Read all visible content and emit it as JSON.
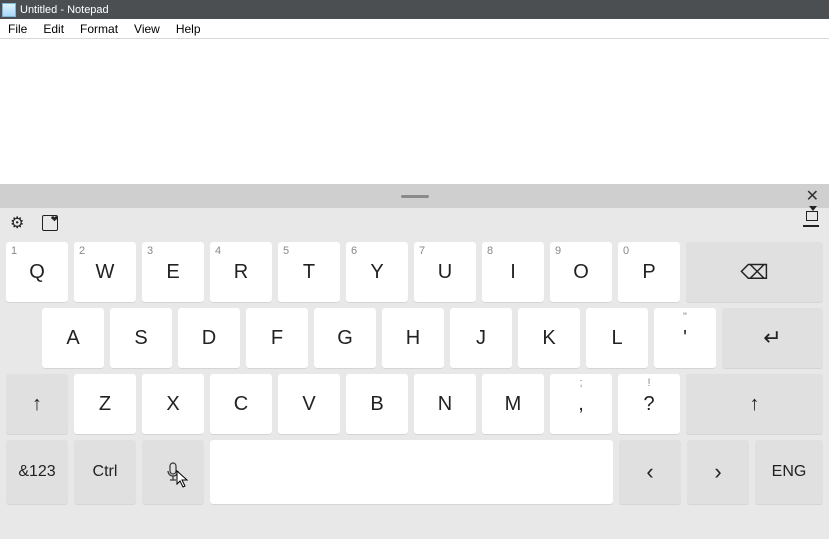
{
  "title": "Untitled - Notepad",
  "menu": {
    "file": "File",
    "edit": "Edit",
    "format": "Format",
    "view": "View",
    "help": "Help"
  },
  "osk": {
    "row1": [
      {
        "num": "1",
        "ch": "Q"
      },
      {
        "num": "2",
        "ch": "W"
      },
      {
        "num": "3",
        "ch": "E"
      },
      {
        "num": "4",
        "ch": "R"
      },
      {
        "num": "5",
        "ch": "T"
      },
      {
        "num": "6",
        "ch": "Y"
      },
      {
        "num": "7",
        "ch": "U"
      },
      {
        "num": "8",
        "ch": "I"
      },
      {
        "num": "9",
        "ch": "O"
      },
      {
        "num": "0",
        "ch": "P"
      }
    ],
    "row2": [
      "A",
      "S",
      "D",
      "F",
      "G",
      "H",
      "J",
      "K",
      "L"
    ],
    "row2_apos": "'",
    "row3": [
      "Z",
      "X",
      "C",
      "V",
      "B",
      "N",
      "M"
    ],
    "row3_sym1_alt": ";",
    "row3_sym1": ",",
    "row3_sym2_alt": "!",
    "row3_sym2": "?",
    "backspace": "⌫",
    "enter": "↵",
    "shift": "↑",
    "numsym": "&123",
    "ctrl": "Ctrl",
    "left": "‹",
    "right": "›",
    "lang": "ENG",
    "close": "✕"
  }
}
